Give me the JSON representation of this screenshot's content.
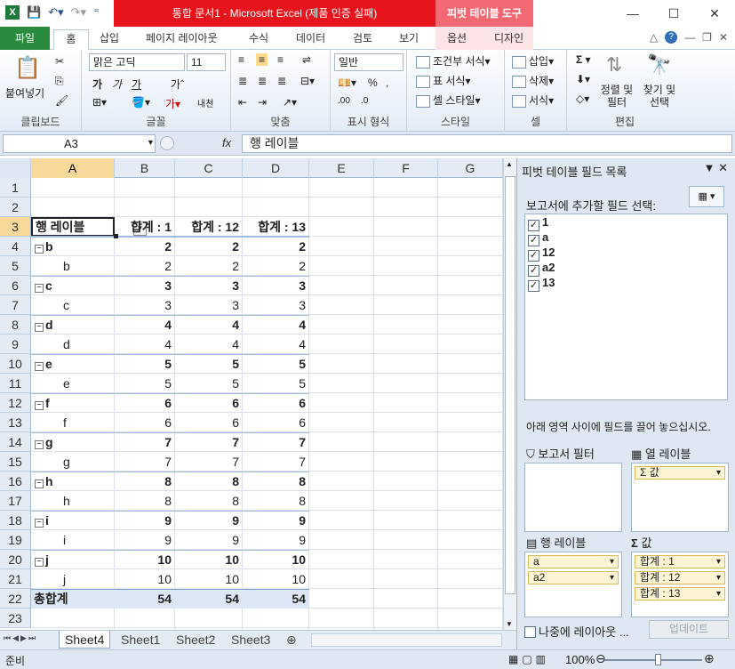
{
  "window": {
    "title": "통합 문서1 - Microsoft Excel (제품 인증 실패)",
    "context_tab_group": "피벗 테이블 도구",
    "accent": "#e8141b"
  },
  "ribbon_tabs": [
    "파일",
    "홈",
    "삽입",
    "페이지 레이아웃",
    "수식",
    "데이터",
    "검토",
    "보기",
    "옵션",
    "디자인"
  ],
  "ribbon": {
    "clipboard": {
      "label": "클립보드",
      "paste": "붙여넣기"
    },
    "font": {
      "label": "글꼴",
      "font_name": "맑은 고딕",
      "font_size": "11",
      "bold": "가",
      "italic": "가",
      "underline": "가"
    },
    "alignment": {
      "label": "맞춤"
    },
    "number": {
      "label": "표시 형식",
      "format": "일반"
    },
    "styles": {
      "label": "스타일",
      "conditional": "조건부 서식",
      "table": "표 서식",
      "cell": "셀 스타일"
    },
    "cells": {
      "label": "셀",
      "insert": "삽입",
      "delete": "삭제",
      "format": "서식"
    },
    "editing": {
      "label": "편집",
      "sort": "정렬 및 필터",
      "find": "찾기 및 선택"
    }
  },
  "formula_bar": {
    "name_box": "A3",
    "fx": "fx",
    "formula": "행 레이블"
  },
  "columns": [
    "A",
    "B",
    "C",
    "D",
    "E",
    "F",
    "G"
  ],
  "rows": [
    "1",
    "2",
    "3",
    "4",
    "5",
    "6",
    "7",
    "8",
    "9",
    "10",
    "11",
    "12",
    "13",
    "14",
    "15",
    "16",
    "17",
    "18",
    "19",
    "20",
    "21",
    "22",
    "23"
  ],
  "pivot": {
    "headers": [
      "행 레이블",
      "합계 : 1",
      "합계 : 12",
      "합계 : 13"
    ],
    "data_rows": [
      {
        "label": "b",
        "values": [
          "2",
          "2",
          "2"
        ],
        "group": true
      },
      {
        "label": "b",
        "values": [
          "2",
          "2",
          "2"
        ],
        "group": false
      },
      {
        "label": "c",
        "values": [
          "3",
          "3",
          "3"
        ],
        "group": true
      },
      {
        "label": "c",
        "values": [
          "3",
          "3",
          "3"
        ],
        "group": false
      },
      {
        "label": "d",
        "values": [
          "4",
          "4",
          "4"
        ],
        "group": true
      },
      {
        "label": "d",
        "values": [
          "4",
          "4",
          "4"
        ],
        "group": false
      },
      {
        "label": "e",
        "values": [
          "5",
          "5",
          "5"
        ],
        "group": true
      },
      {
        "label": "e",
        "values": [
          "5",
          "5",
          "5"
        ],
        "group": false
      },
      {
        "label": "f",
        "values": [
          "6",
          "6",
          "6"
        ],
        "group": true
      },
      {
        "label": "f",
        "values": [
          "6",
          "6",
          "6"
        ],
        "group": false
      },
      {
        "label": "g",
        "values": [
          "7",
          "7",
          "7"
        ],
        "group": true
      },
      {
        "label": "g",
        "values": [
          "7",
          "7",
          "7"
        ],
        "group": false
      },
      {
        "label": "h",
        "values": [
          "8",
          "8",
          "8"
        ],
        "group": true
      },
      {
        "label": "h",
        "values": [
          "8",
          "8",
          "8"
        ],
        "group": false
      },
      {
        "label": "i",
        "values": [
          "9",
          "9",
          "9"
        ],
        "group": true
      },
      {
        "label": "i",
        "values": [
          "9",
          "9",
          "9"
        ],
        "group": false
      },
      {
        "label": "j",
        "values": [
          "10",
          "10",
          "10"
        ],
        "group": true
      },
      {
        "label": "j",
        "values": [
          "10",
          "10",
          "10"
        ],
        "group": false
      }
    ],
    "total": {
      "label": "총합계",
      "values": [
        "54",
        "54",
        "54"
      ]
    }
  },
  "sheet_tabs": [
    "Sheet4",
    "Sheet1",
    "Sheet2",
    "Sheet3"
  ],
  "field_panel": {
    "title": "피벗 테이블 필드 목록",
    "choose_label": "보고서에 추가할 필드 선택:",
    "fields": [
      "1",
      "a",
      "12",
      "a2",
      "13"
    ],
    "drag_note": "아래 영역 사이에 필드를 끌어 놓으십시오.",
    "report_filter": "보고서 필터",
    "column_labels": "열 레이블",
    "row_labels": "행 레이블",
    "values": "값",
    "column_items": [
      "Σ 값"
    ],
    "row_items": [
      "a",
      "a2"
    ],
    "value_items": [
      "합계 : 1",
      "합계 : 12",
      "합계 : 13"
    ],
    "defer": "나중에 레이아웃 ...",
    "update": "업데이트"
  },
  "status": {
    "ready": "준비",
    "zoom": "100%"
  }
}
